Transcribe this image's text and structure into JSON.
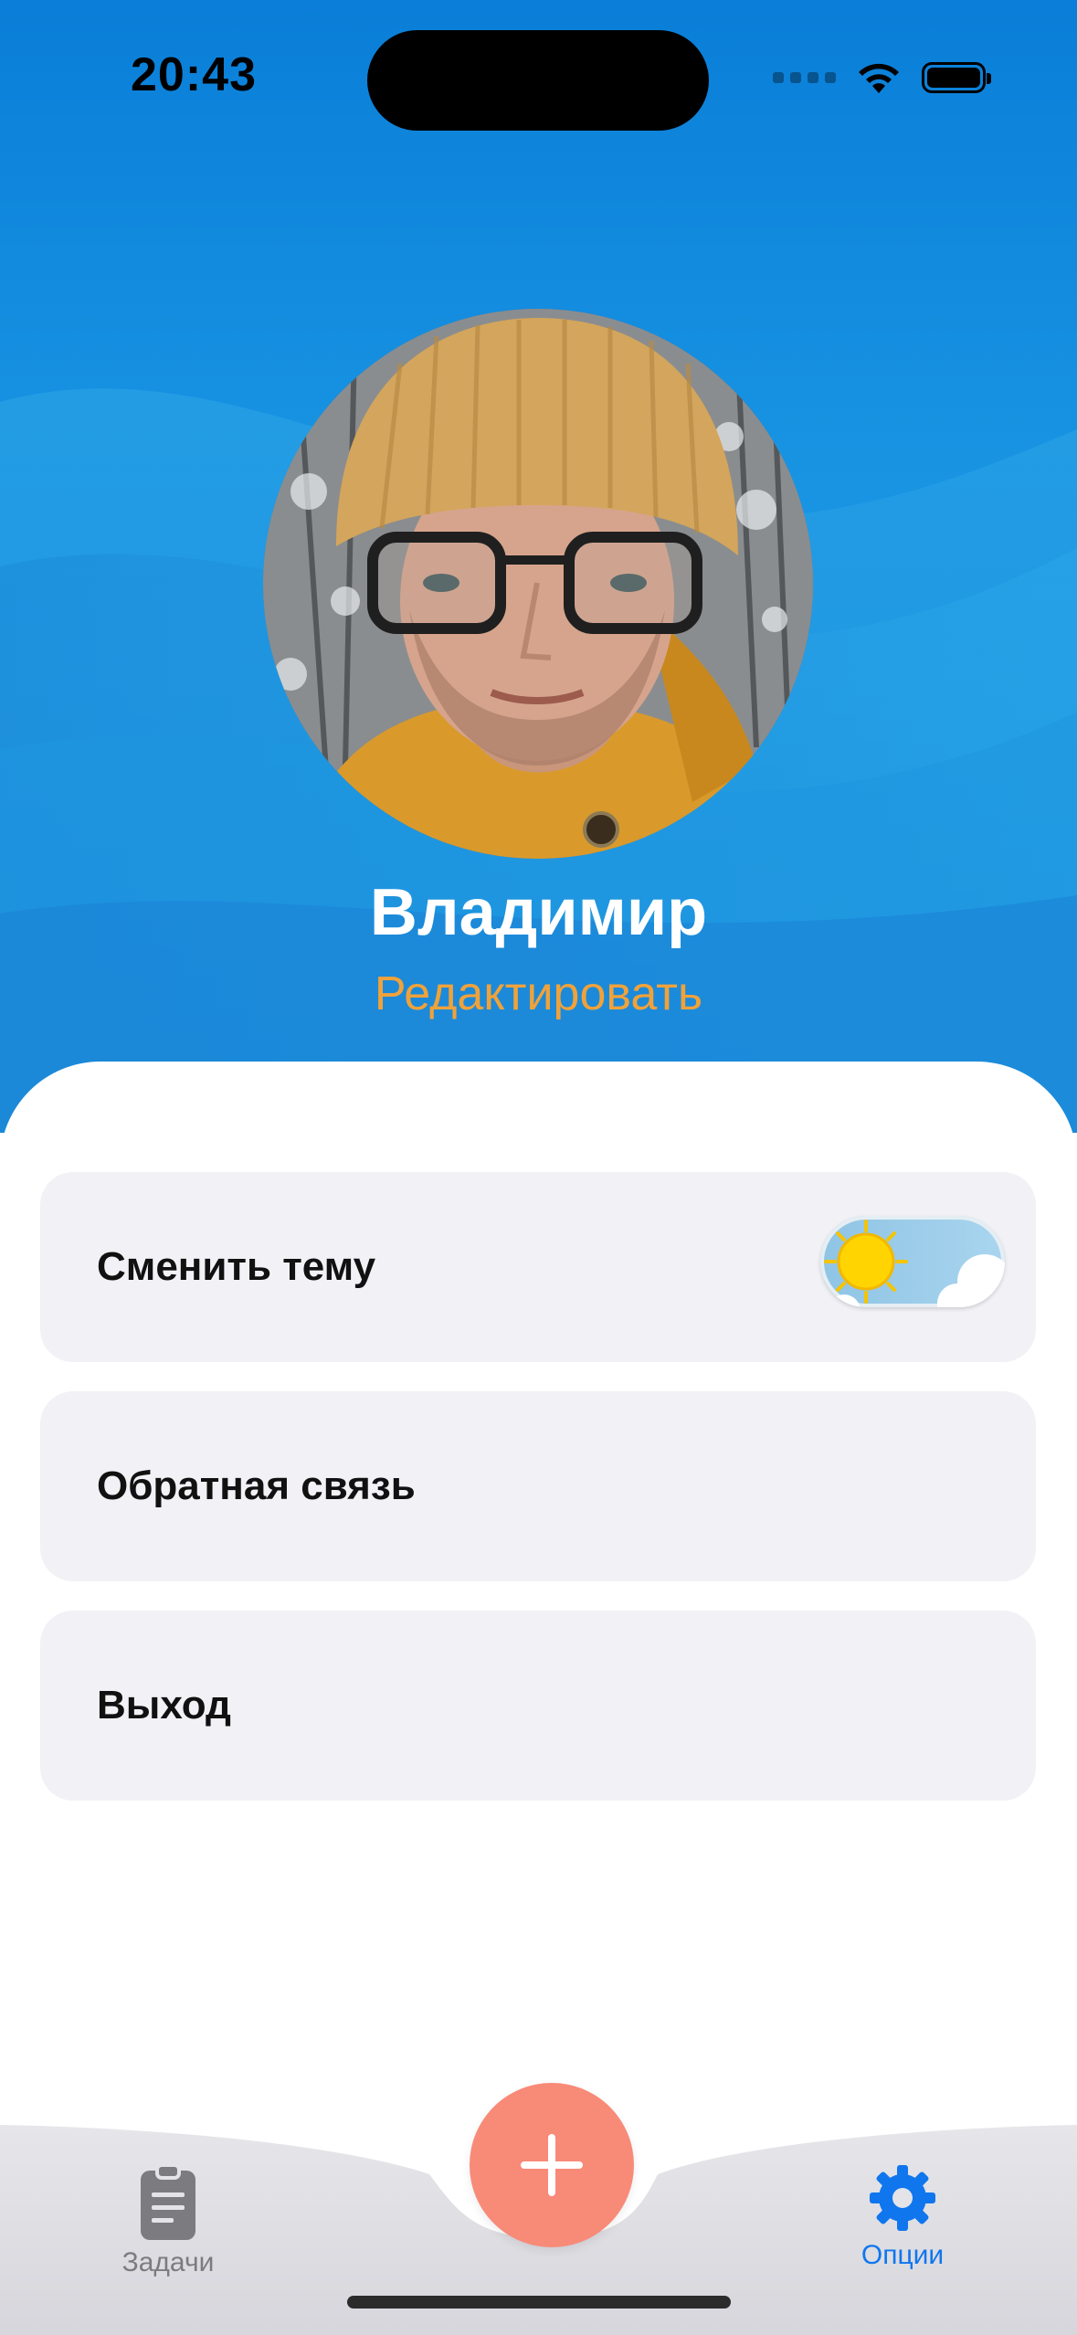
{
  "status_bar": {
    "time": "20:43"
  },
  "profile": {
    "name": "Владимир",
    "edit_label": "Редактировать"
  },
  "settings": {
    "items": [
      {
        "label": "Сменить тему",
        "has_toggle": true,
        "toggle_state": "light"
      },
      {
        "label": "Обратная связь"
      },
      {
        "label": "Выход"
      }
    ]
  },
  "tab_bar": {
    "tabs": [
      {
        "label": "Задачи",
        "icon": "clipboard-icon",
        "active": false
      },
      {
        "label": "Опции",
        "icon": "gear-icon",
        "active": true
      }
    ],
    "fab_icon": "plus-icon"
  },
  "colors": {
    "header_blue": "#1893e2",
    "accent_orange": "#f0a23a",
    "fab_coral": "#f88a78",
    "active_tab_blue": "#1076ee",
    "row_background": "#f1f1f6"
  }
}
